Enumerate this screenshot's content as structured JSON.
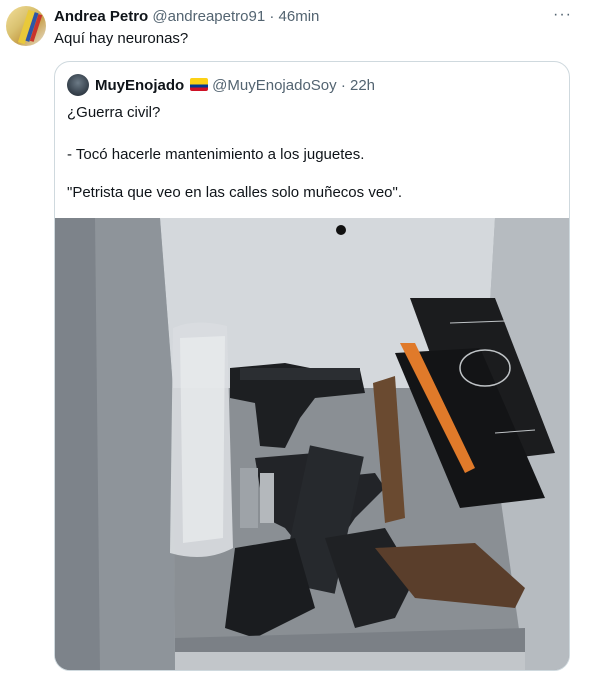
{
  "tweet": {
    "author_name": "Andrea Petro",
    "author_handle": "@andreapetro91",
    "separator": "·",
    "time": "46min",
    "more_label": "···",
    "text": "Aquí hay neuronas?"
  },
  "quoted_tweet": {
    "author_name": "MuyEnojado",
    "author_handle": "@MuyEnojadoSoy",
    "separator": "·",
    "time": "22h",
    "line_1": "¿Guerra civil?",
    "line_2": "- Tocó hacerle mantenimiento a los juguetes.",
    "line_3": "\"Petrista que veo en las calles solo muñecos veo\"."
  },
  "colors": {
    "text": "#0f1419",
    "secondary": "#536471",
    "border": "#cfd9de"
  },
  "icons": [
    "more-icon",
    "colombia-flag-icon",
    "avatar"
  ]
}
